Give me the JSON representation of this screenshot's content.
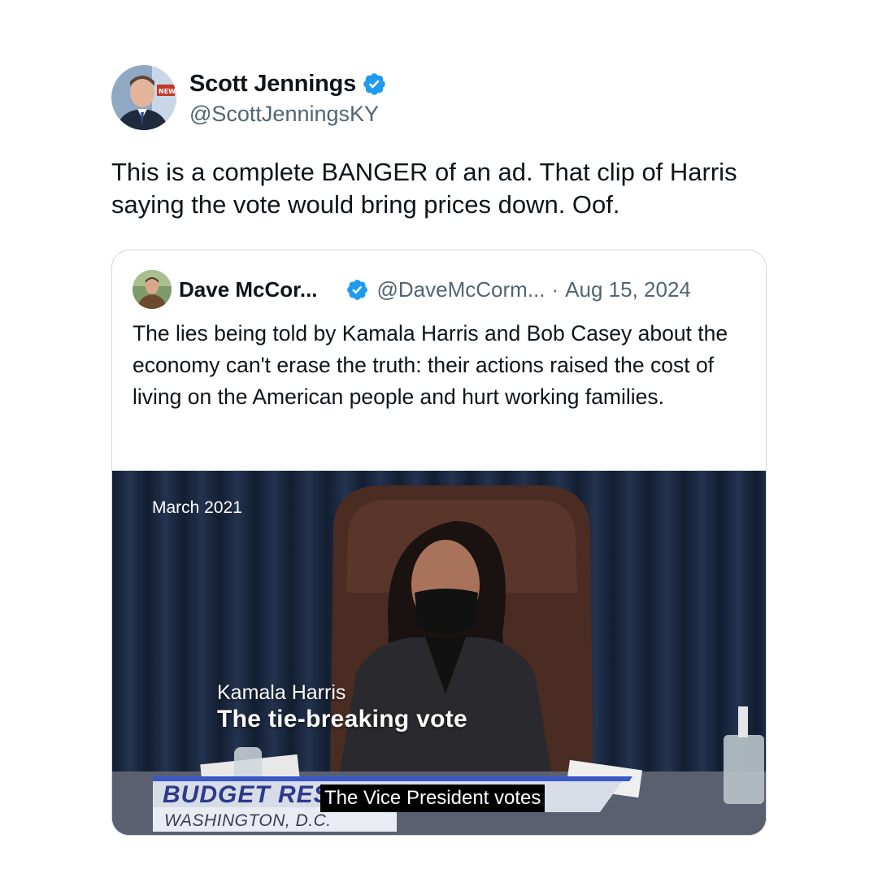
{
  "author": {
    "name": "Scott Jennings",
    "handle": "@ScottJenningsKY",
    "verified_icon": "verified-badge-icon",
    "avatar_news_text": "NEWS"
  },
  "tweet": {
    "text": "This is a complete BANGER of an ad. That clip of Harris saying the vote would bring prices down. Oof."
  },
  "quoted": {
    "name": "Dave McCor...",
    "handle": "@DaveMcCorm...",
    "separator": "·",
    "date": "Aug 15, 2024",
    "text": "The lies being told by Kamala Harris and Bob Casey about the economy can't erase the truth: their actions raised the cost of living on the American people and hurt working families.",
    "media": {
      "date_label": "March 2021",
      "person_name": "Kamala Harris",
      "title": "The tie-breaking vote",
      "banner": "BUDGET RES",
      "location": "WASHINGTON, D.C.",
      "caption": "The Vice President votes"
    }
  },
  "colors": {
    "verified": "#1d9bf0",
    "secondary_text": "#536471",
    "border": "#cfd9de"
  }
}
